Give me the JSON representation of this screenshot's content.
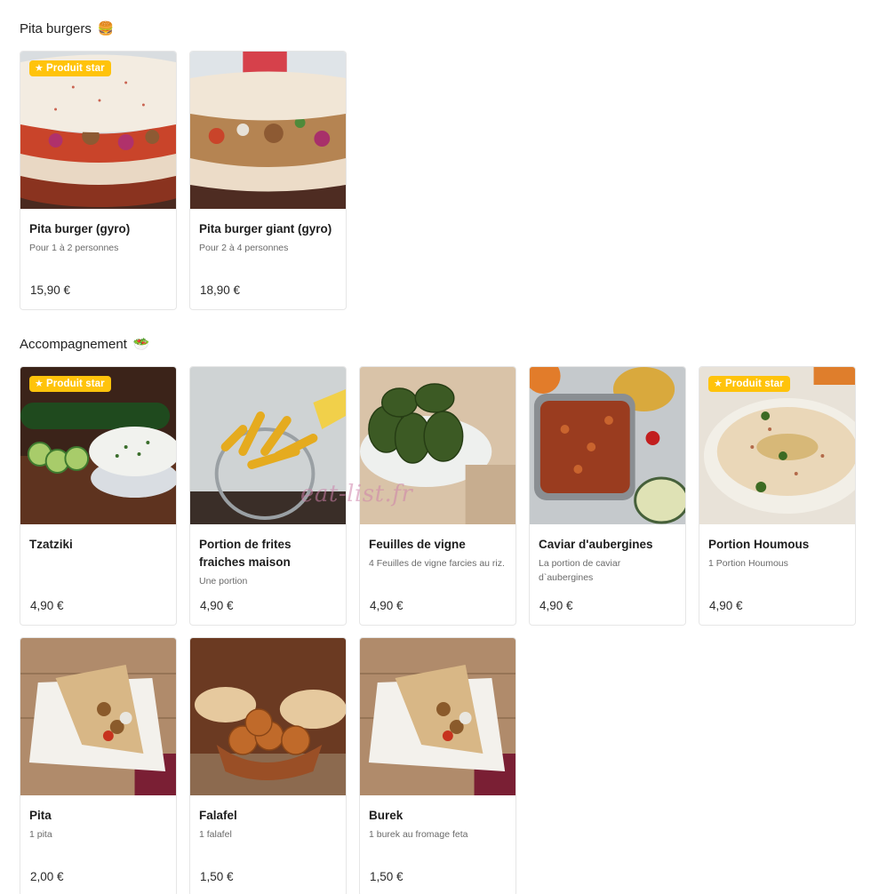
{
  "sections": [
    {
      "title": "Pita burgers",
      "icon": "burger-emoji-icon",
      "items": [
        {
          "name": "Pita burger (gyro)",
          "desc": "Pour 1 à 2 personnes",
          "price": "15,90 €",
          "badge": "Produit star"
        },
        {
          "name": "Pita burger giant (gyro)",
          "desc": "Pour 2 à 4 personnes",
          "price": "18,90 €",
          "badge": ""
        }
      ]
    },
    {
      "title": "Accompagnement",
      "icon": "salad-emoji-icon",
      "items": [
        {
          "name": "Tzatziki",
          "desc": "",
          "price": "4,90 €",
          "badge": "Produit star"
        },
        {
          "name": "Portion de frites fraiches maison",
          "desc": "Une portion",
          "price": "4,90 €",
          "badge": ""
        },
        {
          "name": "Feuilles de vigne",
          "desc": "4 Feuilles de vigne farcies au riz.",
          "price": "4,90 €",
          "badge": ""
        },
        {
          "name": "Caviar d'aubergines",
          "desc": "La portion de caviar d`aubergines",
          "price": "4,90 €",
          "badge": ""
        },
        {
          "name": "Portion Houmous",
          "desc": "1 Portion Houmous",
          "price": "4,90 €",
          "badge": "Produit star"
        },
        {
          "name": "Pita",
          "desc": "1 pita",
          "price": "2,00 €",
          "badge": ""
        },
        {
          "name": "Falafel",
          "desc": "1 falafel",
          "price": "1,50 €",
          "badge": ""
        },
        {
          "name": "Burek",
          "desc": "1 burek au fromage feta",
          "price": "1,50 €",
          "badge": ""
        }
      ]
    }
  ],
  "badge_star": "★",
  "watermark": "eat-list.fr",
  "colors": {
    "badge": "#ffc30b",
    "border": "#e6e6e6",
    "desc": "#6a6a6a"
  }
}
